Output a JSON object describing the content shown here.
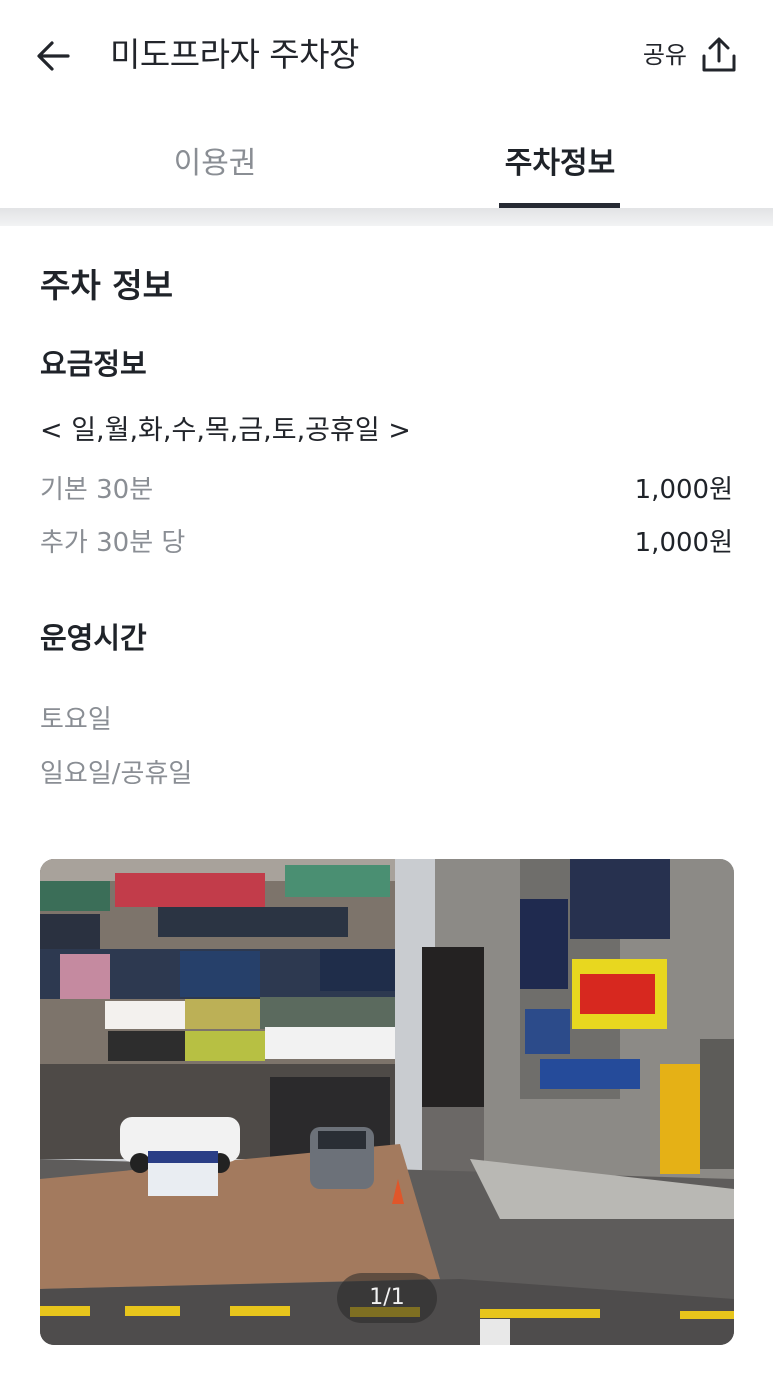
{
  "header": {
    "title": "미도프라자 주차장",
    "back_icon": "arrow-left-icon",
    "share_label": "공유",
    "share_icon": "share-upload-icon"
  },
  "tabs": [
    {
      "label": "이용권",
      "active": false
    },
    {
      "label": "주차정보",
      "active": true
    }
  ],
  "parking_info": {
    "title": "주차 정보",
    "fee": {
      "title": "요금정보",
      "days": "< 일,월,화,수,목,금,토,공휴일 >",
      "rows": [
        {
          "label": "기본 30분",
          "value": "1,000원"
        },
        {
          "label": "추가 30분 당",
          "value": "1,000원"
        }
      ]
    },
    "hours": {
      "title": "운영시간",
      "rows": [
        {
          "label": "토요일"
        },
        {
          "label": "일요일/공휴일"
        }
      ]
    }
  },
  "photo": {
    "counter": "1/1"
  },
  "colors": {
    "text_primary": "#1f2329",
    "text_secondary": "#8a8e94",
    "tab_underline": "#262a33",
    "divider": "#e2e3e5"
  }
}
